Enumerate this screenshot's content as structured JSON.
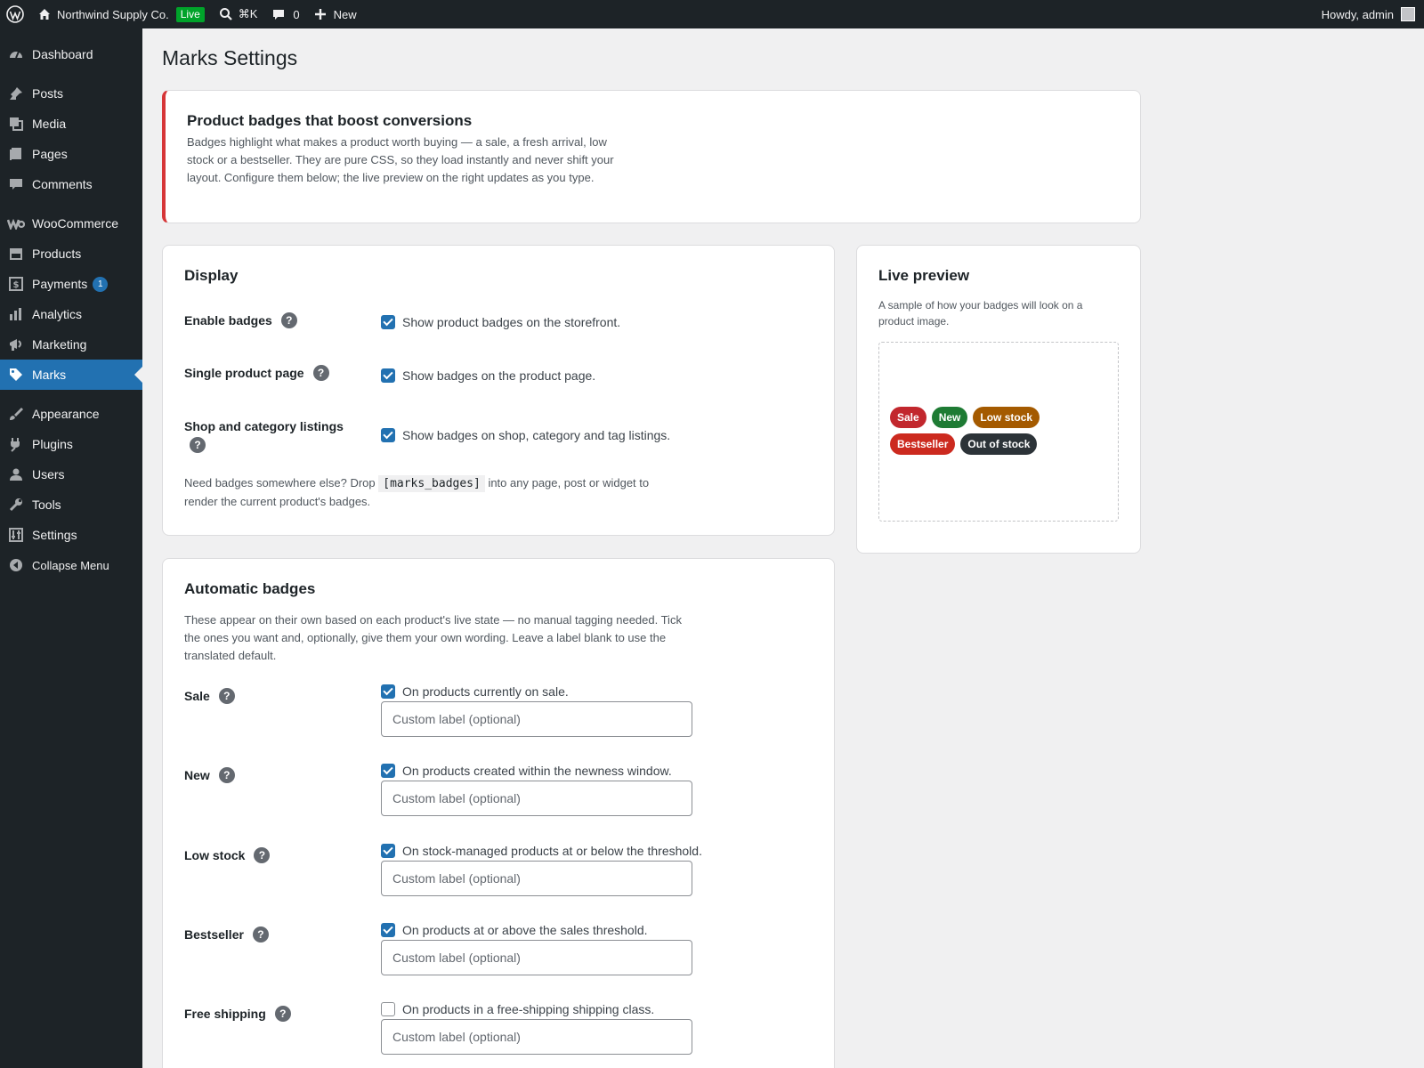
{
  "adminbar": {
    "site_name": "Northwind Supply Co.",
    "live_label": "Live",
    "shortcut": "⌘K",
    "comments_count": "0",
    "new_label": "New",
    "howdy": "Howdy, admin"
  },
  "sidebar": {
    "items": [
      {
        "label": "Dashboard",
        "icon": "dashboard-icon"
      },
      {
        "label": "Posts",
        "icon": "pin-icon"
      },
      {
        "label": "Media",
        "icon": "media-icon"
      },
      {
        "label": "Pages",
        "icon": "pages-icon"
      },
      {
        "label": "Comments",
        "icon": "comment-icon"
      },
      {
        "label": "WooCommerce",
        "icon": "woocommerce-icon"
      },
      {
        "label": "Products",
        "icon": "archive-icon"
      },
      {
        "label": "Payments",
        "icon": "payments-icon",
        "badge": "1"
      },
      {
        "label": "Analytics",
        "icon": "chart-bar-icon"
      },
      {
        "label": "Marketing",
        "icon": "megaphone-icon"
      },
      {
        "label": "Marks",
        "icon": "tag-icon",
        "current": true
      },
      {
        "label": "Appearance",
        "icon": "brush-icon"
      },
      {
        "label": "Plugins",
        "icon": "plugin-icon"
      },
      {
        "label": "Users",
        "icon": "user-icon"
      },
      {
        "label": "Tools",
        "icon": "wrench-icon"
      },
      {
        "label": "Settings",
        "icon": "settings-icon"
      }
    ],
    "collapse": "Collapse Menu"
  },
  "page": {
    "title": "Marks Settings"
  },
  "intro": {
    "title": "Product badges that boost conversions",
    "text": "Badges highlight what makes a product worth buying — a sale, a fresh arrival, low stock or a bestseller. They are pure CSS, so they load instantly and never shift your layout. Configure them below; the live preview on the right updates as you type."
  },
  "display": {
    "title": "Display",
    "rows": [
      {
        "label": "Enable badges",
        "checkbox": "Show product badges on the storefront.",
        "checked": true
      },
      {
        "label": "Single product page",
        "checkbox": "Show badges on the product page.",
        "checked": true
      },
      {
        "label": "Shop and category listings",
        "checkbox": "Show badges on shop, category and tag listings.",
        "checked": true
      }
    ],
    "note_before": "Need badges somewhere else? Drop ",
    "shortcode": "[marks_badges]",
    "note_after": " into any page, post or widget to render the current product's badges."
  },
  "auto": {
    "title": "Automatic badges",
    "description": "These appear on their own based on each product's live state — no manual tagging needed. Tick the ones you want and, optionally, give them your own wording. Leave a label blank to use the translated default.",
    "placeholder": "Custom label (optional)",
    "rows": [
      {
        "label": "Sale",
        "checkbox": "On products currently on sale.",
        "checked": true
      },
      {
        "label": "New",
        "checkbox": "On products created within the newness window.",
        "checked": true
      },
      {
        "label": "Low stock",
        "checkbox": "On stock-managed products at or below the threshold.",
        "checked": true
      },
      {
        "label": "Bestseller",
        "checkbox": "On products at or above the sales threshold.",
        "checked": true
      },
      {
        "label": "Free shipping",
        "checkbox": "On products in a free-shipping shipping class.",
        "checked": false
      }
    ]
  },
  "preview": {
    "title": "Live preview",
    "description": "A sample of how your badges will look on a product image.",
    "badges": [
      {
        "label": "Sale",
        "color": "#c2272d"
      },
      {
        "label": "New",
        "color": "#1e7b34"
      },
      {
        "label": "Low stock",
        "color": "#a45a00"
      },
      {
        "label": "Bestseller",
        "color": "#cc2a1f"
      },
      {
        "label": "Out of stock",
        "color": "#2c3338"
      }
    ]
  },
  "colors": {
    "accent": "#2271b1",
    "adminbar": "#1d2327",
    "notice_border": "#d63638",
    "live": "#00a32a"
  }
}
